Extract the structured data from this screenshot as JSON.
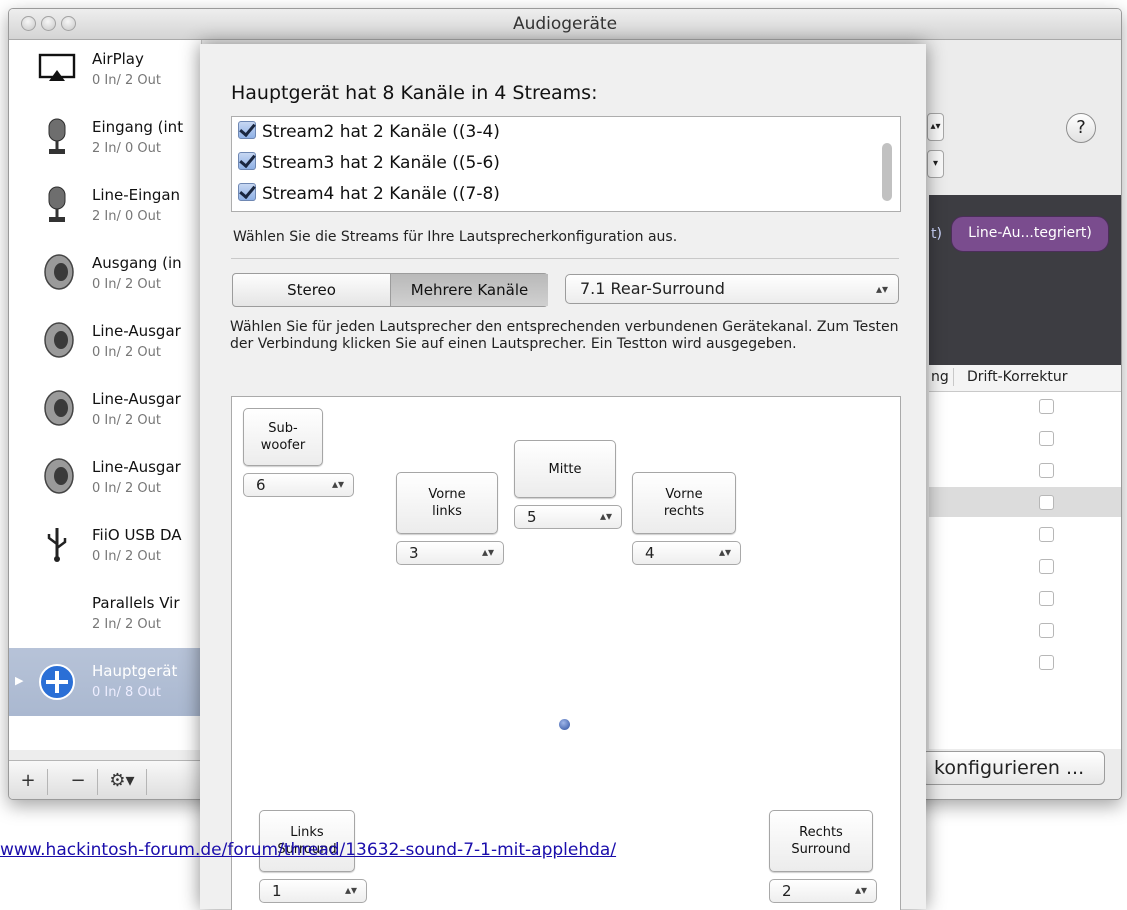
{
  "window": {
    "title": "Audiogeräte"
  },
  "devices": [
    {
      "name": "AirPlay",
      "io": "0 In/ 2 Out",
      "icon": "airplay-icon"
    },
    {
      "name": "Eingang (int",
      "io": "2 In/ 0 Out",
      "icon": "microphone-icon"
    },
    {
      "name": "Line-Eingan",
      "io": "2 In/ 0 Out",
      "icon": "microphone-icon"
    },
    {
      "name": "Ausgang (in",
      "io": "0 In/ 2 Out",
      "icon": "speaker-icon"
    },
    {
      "name": "Line-Ausgar",
      "io": "0 In/ 2 Out",
      "icon": "speaker-icon"
    },
    {
      "name": "Line-Ausgar",
      "io": "0 In/ 2 Out",
      "icon": "speaker-icon"
    },
    {
      "name": "Line-Ausgar",
      "io": "0 In/ 2 Out",
      "icon": "speaker-icon"
    },
    {
      "name": "FiiO USB DA",
      "io": "0 In/ 2 Out",
      "icon": "usb-icon"
    },
    {
      "name": "Parallels Vir",
      "io": "2 In/ 2 Out",
      "icon": ""
    },
    {
      "name": "Hauptgerät",
      "io": "0 In/ 8 Out",
      "icon": "aggregate-plus-icon",
      "selected": true
    }
  ],
  "sidebar_toolbar": {
    "add": "+",
    "remove": "−",
    "gear": "⚙▾"
  },
  "background": {
    "pill": "Line-Au...tegriert)",
    "pill_prefix": "t)",
    "header_left": "ng",
    "header_right": "Drift-Korrektur",
    "configure_button": "konfigurieren ...",
    "help": "?"
  },
  "sheet": {
    "title": "Hauptgerät hat 8 Kanäle in 4 Streams:",
    "streams": [
      {
        "label": "Stream2 hat 2 Kanäle ((3-4)",
        "checked": true
      },
      {
        "label": "Stream3 hat 2 Kanäle ((5-6)",
        "checked": true
      },
      {
        "label": "Stream4 hat 2 Kanäle ((7-8)",
        "checked": true
      }
    ],
    "stream_hint": "Wählen Sie die Streams für Ihre Lautsprecherkonfiguration aus.",
    "segment": {
      "stereo": "Stereo",
      "multi": "Mehrere Kanäle",
      "selected": "multi"
    },
    "config_popup": "7.1 Rear-Surround",
    "speaker_hint": "Wählen Sie für jeden Lautsprecher den entsprechenden verbundenen Gerätekanal. Zum Testen der Verbindung klicken Sie auf einen Lautsprecher. Ein Testton wird ausgegeben.",
    "speakers": {
      "subwoofer": {
        "label": "Sub-\nwoofer",
        "channel": "6"
      },
      "front_left": {
        "label": "Vorne\nlinks",
        "channel": "3"
      },
      "center": {
        "label": "Mitte",
        "channel": "5"
      },
      "front_right": {
        "label": "Vorne\nrechts",
        "channel": "4"
      },
      "rear_left": {
        "label": "Links\nSurround",
        "channel": "1"
      },
      "rear_right": {
        "label": "Rechts\nSurround",
        "channel": "2"
      }
    }
  },
  "watermark_url": "www.hackintosh-forum.de/forum/thread/13632-sound-7-1-mit-applehda/"
}
